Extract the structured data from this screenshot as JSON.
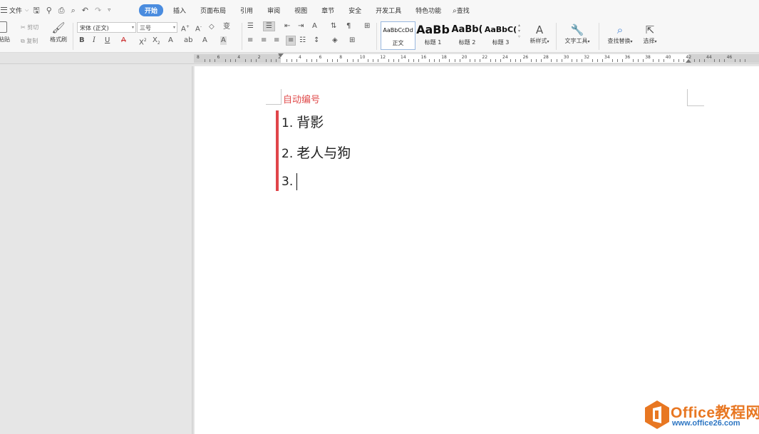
{
  "menubar": {
    "file_menu": "文件",
    "tabs": [
      "开始",
      "插入",
      "页面布局",
      "引用",
      "审阅",
      "视图",
      "章节",
      "安全",
      "开发工具",
      "特色功能"
    ],
    "search": "查找"
  },
  "ribbon": {
    "paste": "粘贴",
    "cut": "剪切",
    "copy": "复制",
    "format_painter": "格式刷",
    "font_name": "宋体 (正文)",
    "font_size": "三号",
    "styles": [
      {
        "sample": "AaBbCcDd",
        "label": "正文"
      },
      {
        "sample": "AaBb",
        "label": "标题 1"
      },
      {
        "sample": "AaBb(",
        "label": "标题 2"
      },
      {
        "sample": "AaBbC(",
        "label": "标题 3"
      }
    ],
    "new_style": "新样式",
    "text_tools": "文字工具",
    "find_replace": "查找替换",
    "select": "选择"
  },
  "ruler": {
    "labels": [
      "8",
      "6",
      "4",
      "2",
      "2",
      "4",
      "6",
      "8",
      "10",
      "12",
      "14",
      "16",
      "18",
      "20",
      "22",
      "24",
      "26",
      "28",
      "30",
      "32",
      "34",
      "36",
      "38",
      "40",
      "42",
      "44",
      "46"
    ]
  },
  "document": {
    "title": "自动编号",
    "items": [
      {
        "num": "1.",
        "text": "背影"
      },
      {
        "num": "2.",
        "text": "老人与狗"
      },
      {
        "num": "3.",
        "text": ""
      }
    ]
  },
  "watermark": {
    "brand": "Office教程网",
    "url": "www.office26.com"
  },
  "colors": {
    "accent_tab": "#4a8cdf",
    "title_red": "#e04b4b",
    "list_bar": "#e0454a",
    "watermark_orange": "#e87722",
    "watermark_blue": "#2e76c3"
  }
}
